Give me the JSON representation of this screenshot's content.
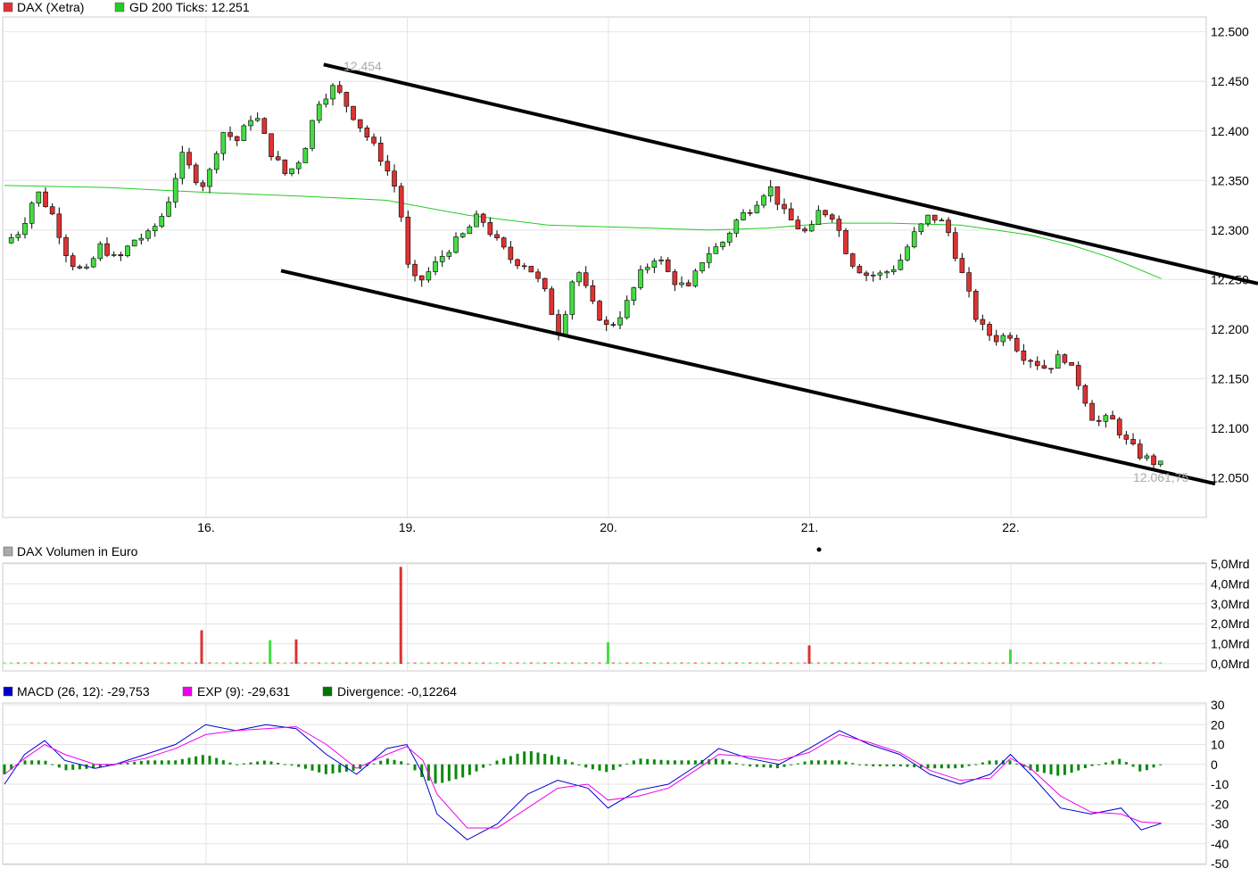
{
  "legend": {
    "price": {
      "label": "DAX (Xetra)",
      "color": "#dd3333"
    },
    "ma": {
      "label": "GD 200 Ticks: 12.251",
      "color": "#22cc22"
    },
    "volume": {
      "label": "DAX Volumen in Euro",
      "color": "#aaaaaa"
    },
    "macd": {
      "label": "MACD (26, 12): -29,753",
      "color": "#0000cc"
    },
    "exp": {
      "label": "EXP (9): -29,631",
      "color": "#ee00ee"
    },
    "divergence": {
      "label": "Divergence: -0,12264",
      "color": "#007700"
    }
  },
  "chart_data": [
    {
      "type": "candlestick",
      "title": "DAX (Xetra)",
      "y_ticks": [
        "12.500",
        "12.450",
        "12.400",
        "12.350",
        "12.300",
        "12.250",
        "12.200",
        "12.150",
        "12.100",
        "12.050"
      ],
      "y_tick_values": [
        12500,
        12450,
        12400,
        12350,
        12300,
        12250,
        12200,
        12150,
        12100,
        12050
      ],
      "ylim": [
        12010,
        12515
      ],
      "x_ticks": [
        "16.",
        "19.",
        "20.",
        "21.",
        "22."
      ],
      "annotations": {
        "high_label": "12.454",
        "last_label": "12.061,75"
      },
      "trend_channel": {
        "upper": [
          [
            0.5,
            12467
          ],
          [
            5.65,
            12246
          ]
        ],
        "lower": [
          [
            0.3,
            12259
          ],
          [
            5.5,
            12044
          ]
        ]
      },
      "ma_label": "GD 200 Ticks",
      "ma_x": [
        0,
        0.5,
        1.0,
        1.5,
        1.9,
        2.3,
        2.7,
        3.2,
        3.5,
        3.8,
        4.1,
        4.4,
        4.75,
        5.1,
        5.3,
        5.5,
        5.75
      ],
      "ma_y": [
        12345,
        12343,
        12338,
        12334,
        12330,
        12315,
        12305,
        12302,
        12300,
        12302,
        12307,
        12307,
        12305,
        12295,
        12285,
        12272,
        12251
      ],
      "price_x": [
        0,
        0.08,
        0.16,
        0.24,
        0.32,
        0.4,
        0.48,
        0.56,
        0.64,
        0.72,
        0.8,
        0.88,
        0.96,
        1.0,
        1.08,
        1.16,
        1.24,
        1.32,
        1.4,
        1.48,
        1.56,
        1.64,
        1.72,
        1.8,
        1.88,
        1.96,
        2.0,
        2.05,
        2.12,
        2.2,
        2.28,
        2.36,
        2.44,
        2.52,
        2.6,
        2.68,
        2.76,
        2.84,
        2.92,
        3.0,
        3.08,
        3.16,
        3.24,
        3.32,
        3.4,
        3.48,
        3.56,
        3.64,
        3.72,
        3.8,
        3.88,
        3.96,
        4.0,
        4.05,
        4.12,
        4.2,
        4.28,
        4.36,
        4.44,
        4.52,
        4.6,
        4.68,
        4.76,
        4.84,
        4.92,
        5.0,
        5.05,
        5.1,
        5.18,
        5.26,
        5.34,
        5.42,
        5.5,
        5.58,
        5.65,
        5.75
      ],
      "price_y": [
        12287,
        12300,
        12340,
        12315,
        12270,
        12255,
        12285,
        12268,
        12290,
        12295,
        12320,
        12375,
        12350,
        12345,
        12400,
        12390,
        12420,
        12380,
        12355,
        12375,
        12430,
        12445,
        12420,
        12395,
        12370,
        12335,
        12265,
        12245,
        12260,
        12280,
        12295,
        12315,
        12290,
        12270,
        12265,
        12240,
        12195,
        12265,
        12225,
        12200,
        12220,
        12255,
        12275,
        12250,
        12240,
        12275,
        12285,
        12310,
        12325,
        12345,
        12315,
        12300,
        12295,
        12320,
        12315,
        12270,
        12255,
        12255,
        12265,
        12295,
        12315,
        12305,
        12255,
        12205,
        12190,
        12195,
        12175,
        12170,
        12160,
        12175,
        12145,
        12105,
        12110,
        12085,
        12072,
        12062
      ]
    },
    {
      "type": "bar",
      "title": "DAX Volumen in Euro",
      "y_ticks": [
        "5,0Mrd",
        "4,0Mrd",
        "3,0Mrd",
        "2,0Mrd",
        "1,0Mrd",
        "0,0Mrd"
      ],
      "y_tick_values": [
        5.0,
        4.0,
        3.0,
        2.0,
        1.0,
        0.0
      ],
      "ylim": [
        0,
        5.0
      ],
      "spikes": [
        {
          "x": 0.98,
          "value": 1.68,
          "color": "#dd3333"
        },
        {
          "x": 1.32,
          "value": 1.18,
          "color": "#44dd44"
        },
        {
          "x": 1.45,
          "value": 1.22,
          "color": "#dd3333"
        },
        {
          "x": 1.97,
          "value": 4.85,
          "color": "#dd3333"
        },
        {
          "x": 3.0,
          "value": 1.08,
          "color": "#44dd44"
        },
        {
          "x": 4.0,
          "value": 0.92,
          "color": "#dd3333"
        },
        {
          "x": 5.0,
          "value": 0.72,
          "color": "#44dd44"
        }
      ],
      "base_volume": 0.08
    },
    {
      "type": "line",
      "title": "MACD",
      "y_ticks": [
        "30",
        "20",
        "10",
        "0",
        "-10",
        "-20",
        "-30",
        "-40",
        "-50"
      ],
      "y_tick_values": [
        30,
        20,
        10,
        0,
        -10,
        -20,
        -30,
        -40,
        -50
      ],
      "ylim": [
        -50,
        30
      ],
      "x": [
        0,
        0.1,
        0.2,
        0.3,
        0.45,
        0.55,
        0.7,
        0.85,
        1.0,
        1.15,
        1.3,
        1.45,
        1.6,
        1.75,
        1.9,
        2.0,
        2.08,
        2.15,
        2.3,
        2.45,
        2.6,
        2.75,
        2.9,
        3.0,
        3.15,
        3.3,
        3.45,
        3.55,
        3.7,
        3.85,
        4.0,
        4.15,
        4.3,
        4.45,
        4.6,
        4.75,
        4.9,
        5.0,
        5.1,
        5.25,
        5.4,
        5.55,
        5.65,
        5.75
      ],
      "series": [
        {
          "name": "MACD (26, 12)",
          "values": [
            -10,
            5,
            12,
            2,
            -2,
            0,
            5,
            10,
            20,
            17,
            20,
            18,
            5,
            -5,
            8,
            10,
            -5,
            -25,
            -38,
            -30,
            -15,
            -8,
            -12,
            -22,
            -13,
            -10,
            0,
            8,
            3,
            0,
            8,
            17,
            10,
            5,
            -5,
            -10,
            -5,
            5,
            -5,
            -22,
            -25,
            -22,
            -33,
            -29.753
          ]
        },
        {
          "name": "EXP (9)",
          "values": [
            -5,
            3,
            10,
            5,
            0,
            0,
            3,
            8,
            15,
            17,
            18,
            19,
            10,
            -2,
            5,
            9,
            2,
            -15,
            -32,
            -32,
            -22,
            -12,
            -10,
            -18,
            -16,
            -12,
            -2,
            5,
            4,
            2,
            6,
            15,
            11,
            6,
            -3,
            -8,
            -7,
            3,
            -2,
            -16,
            -24,
            -25,
            -29,
            -29.631
          ]
        }
      ],
      "divergence": [
        -5,
        2,
        2,
        -3,
        -2,
        0,
        2,
        2,
        5,
        0,
        2,
        -1,
        -5,
        -3,
        3,
        1,
        -7,
        -10,
        -6,
        2,
        7,
        4,
        -2,
        -4,
        3,
        2,
        2,
        3,
        -1,
        -2,
        2,
        2,
        -1,
        -1,
        -2,
        -2,
        2,
        2,
        -3,
        -6,
        -1,
        3,
        -4,
        -0.12264
      ]
    }
  ]
}
